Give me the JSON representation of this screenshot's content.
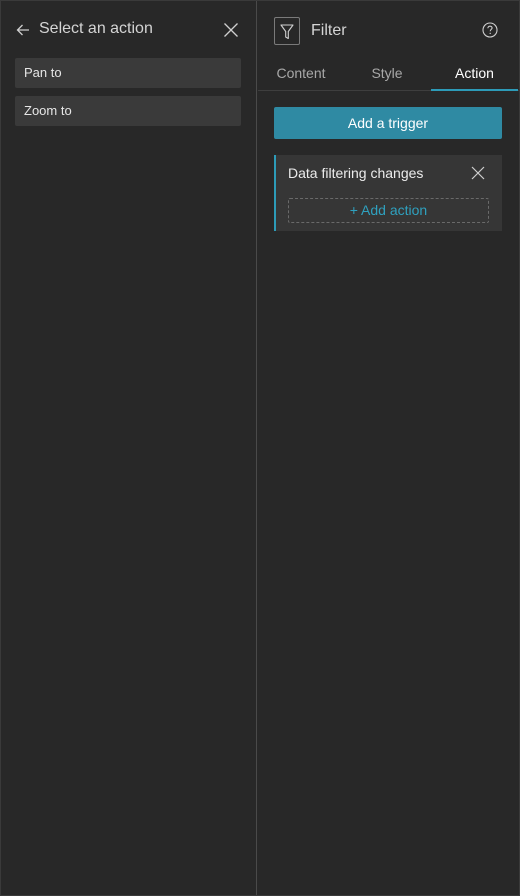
{
  "left_panel": {
    "title": "Select an action",
    "back_icon": "arrow-left-icon",
    "close_icon": "close-icon",
    "actions": [
      {
        "label": "Pan to"
      },
      {
        "label": "Zoom to"
      }
    ]
  },
  "right_panel": {
    "widget_icon": "filter-funnel-icon",
    "title": "Filter",
    "help_icon": "help-circle-icon",
    "tabs": [
      {
        "label": "Content",
        "active": false
      },
      {
        "label": "Style",
        "active": false
      },
      {
        "label": "Action",
        "active": true
      }
    ],
    "add_trigger_label": "Add a trigger",
    "trigger": {
      "title": "Data filtering changes",
      "close_icon": "close-icon",
      "add_action_label": "+ Add action"
    }
  },
  "colors": {
    "background": "#282828",
    "item_background": "#3a3a3a",
    "card_background": "#363636",
    "accent": "#2d9bb8",
    "button_primary": "#2f8aa3",
    "link_text": "#2fa1bf"
  }
}
